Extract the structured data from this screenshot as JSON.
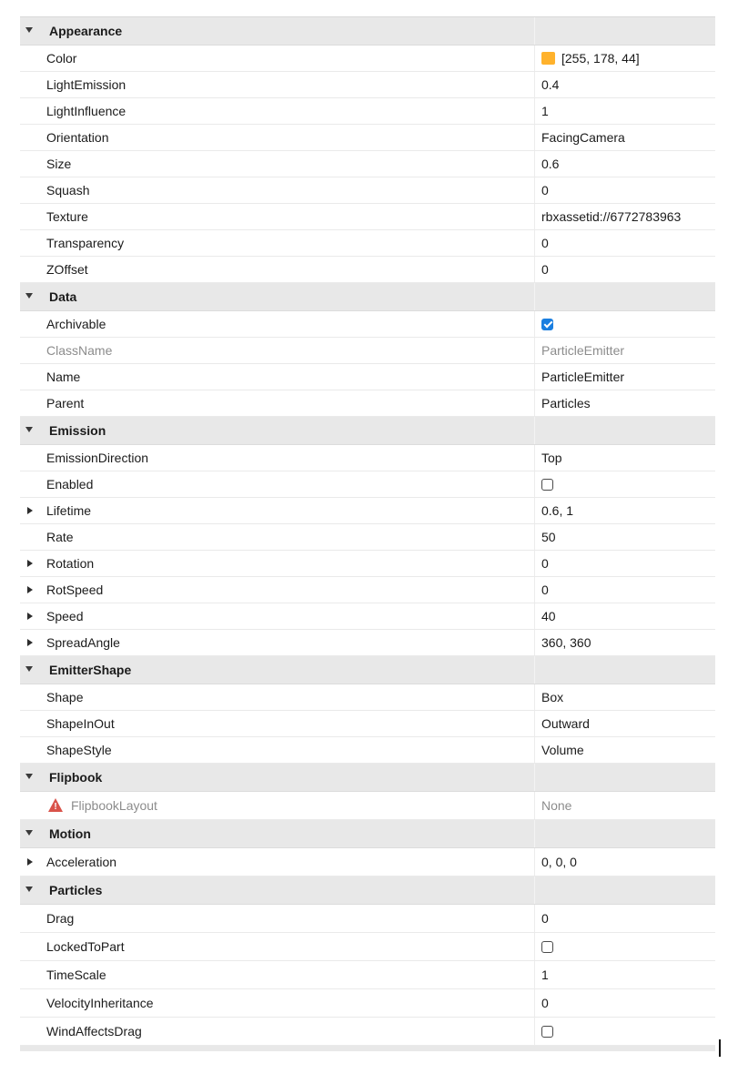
{
  "sections": [
    {
      "title": "Appearance",
      "rows": [
        {
          "name": "Color",
          "value": "[255, 178, 44]",
          "type": "color",
          "color": "#ffb22c"
        },
        {
          "name": "LightEmission",
          "value": "0.4"
        },
        {
          "name": "LightInfluence",
          "value": "1"
        },
        {
          "name": "Orientation",
          "value": "FacingCamera"
        },
        {
          "name": "Size",
          "value": "0.6"
        },
        {
          "name": "Squash",
          "value": "0"
        },
        {
          "name": "Texture",
          "value": "rbxassetid://6772783963"
        },
        {
          "name": "Transparency",
          "value": "0"
        },
        {
          "name": "ZOffset",
          "value": "0"
        }
      ]
    },
    {
      "title": "Data",
      "rows": [
        {
          "name": "Archivable",
          "type": "checkbox",
          "checked": true
        },
        {
          "name": "ClassName",
          "value": "ParticleEmitter",
          "disabled": true
        },
        {
          "name": "Name",
          "value": "ParticleEmitter"
        },
        {
          "name": "Parent",
          "value": "Particles"
        }
      ]
    },
    {
      "title": "Emission",
      "rows": [
        {
          "name": "EmissionDirection",
          "value": "Top"
        },
        {
          "name": "Enabled",
          "type": "checkbox",
          "checked": false
        },
        {
          "name": "Lifetime",
          "value": "0.6, 1",
          "expandable": true
        },
        {
          "name": "Rate",
          "value": "50"
        },
        {
          "name": "Rotation",
          "value": "0",
          "expandable": true
        },
        {
          "name": "RotSpeed",
          "value": "0",
          "expandable": true
        },
        {
          "name": "Speed",
          "value": "40",
          "expandable": true
        },
        {
          "name": "SpreadAngle",
          "value": "360, 360",
          "expandable": true
        }
      ]
    },
    {
      "title": "EmitterShape",
      "rows": [
        {
          "name": "Shape",
          "value": "Box"
        },
        {
          "name": "ShapeInOut",
          "value": "Outward"
        },
        {
          "name": "ShapeStyle",
          "value": "Volume"
        }
      ]
    },
    {
      "title": "Flipbook",
      "rows": [
        {
          "name": "FlipbookLayout",
          "value": "None",
          "disabled": true,
          "warning": true,
          "tall": true
        }
      ]
    },
    {
      "title": "Motion",
      "rows": [
        {
          "name": "Acceleration",
          "value": "0, 0, 0",
          "expandable": true,
          "tall": true
        }
      ]
    },
    {
      "title": "Particles",
      "rows": [
        {
          "name": "Drag",
          "value": "0",
          "tall": true
        },
        {
          "name": "LockedToPart",
          "type": "checkbox",
          "checked": false,
          "tall": true
        },
        {
          "name": "TimeScale",
          "value": "1",
          "tall": true
        },
        {
          "name": "VelocityInheritance",
          "value": "0",
          "tall": true
        },
        {
          "name": "WindAffectsDrag",
          "type": "checkbox",
          "checked": false,
          "tall": true
        }
      ]
    }
  ]
}
